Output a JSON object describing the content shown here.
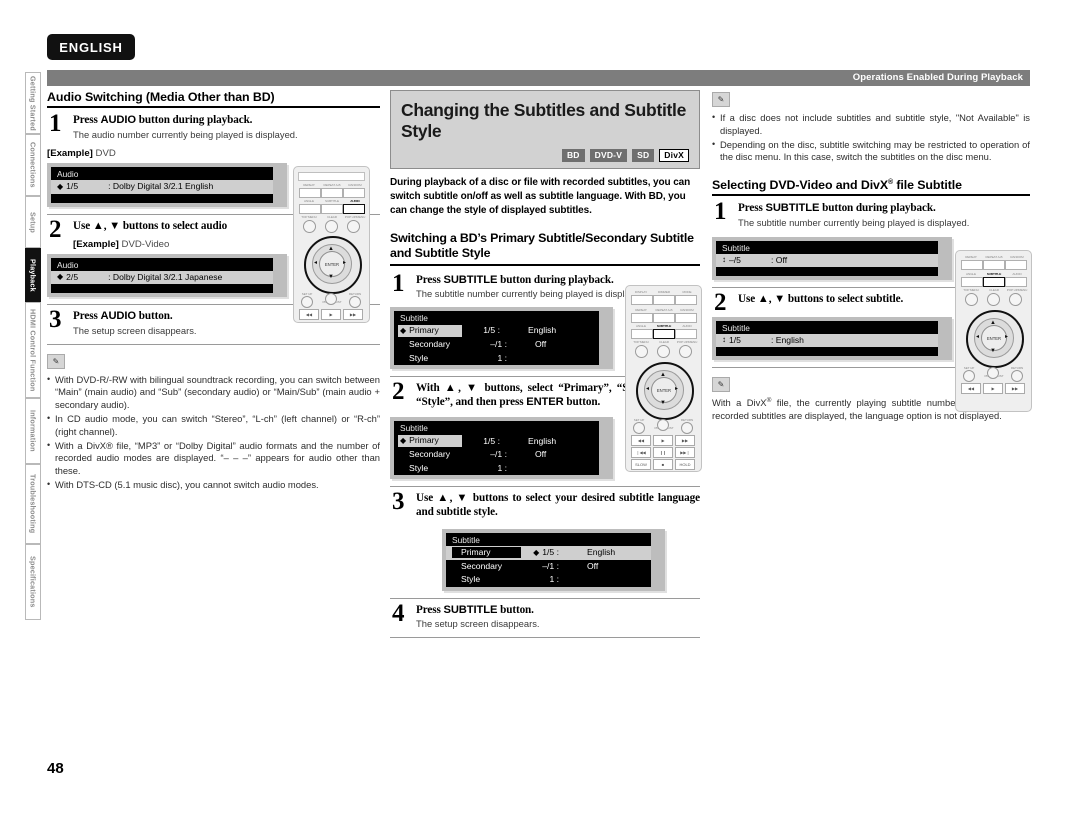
{
  "meta": {
    "language_badge": "ENGLISH",
    "page_number": "48",
    "header_right": "Operations Enabled During Playback"
  },
  "sidebar": {
    "items": [
      {
        "label": "Getting Started",
        "active": false
      },
      {
        "label": "Connections",
        "active": false
      },
      {
        "label": "Setup",
        "active": false
      },
      {
        "label": "Playback",
        "active": true
      },
      {
        "label": "HDMI Control Function",
        "active": false
      },
      {
        "label": "Information",
        "active": false
      },
      {
        "label": "Troubleshooting",
        "active": false
      },
      {
        "label": "Specifications",
        "active": false
      }
    ]
  },
  "col1": {
    "heading": "Audio Switching (Media Other than BD)",
    "steps": [
      {
        "num": "1",
        "title_a": "Press ",
        "title_b": "AUDIO",
        "title_c": " button during playback.",
        "sub": "The audio number currently being played is displayed."
      },
      {
        "num": "2",
        "title_a": "Use ▲, ▼ buttons to select audio",
        "title_b": "",
        "title_c": "",
        "sub": ""
      },
      {
        "num": "3",
        "title_a": "Press ",
        "title_b": "AUDIO",
        "title_c": " button.",
        "sub": "The setup screen disappears."
      }
    ],
    "example1": {
      "label": "[Example]",
      "value": "DVD"
    },
    "example2": {
      "label": "[Example]",
      "value": "DVD-Video"
    },
    "osd1": {
      "title": "Audio",
      "marker": "◆",
      "num": "1/5",
      "value": ": Dolby Digital   3/2.1   English"
    },
    "osd2": {
      "title": "Audio",
      "marker": "◆",
      "num": "2/5",
      "value": ": Dolby Digital   3/2.1   Japanese"
    },
    "notes": [
      "With DVD-R/-RW with bilingual soundtrack recording, you can switch between “Main” (main audio) and “Sub” (secondary audio) or “Main/Sub” (main audio + secondary audio).",
      "In CD audio mode, you can switch “Stereo”, “L-ch” (left channel) or “R-ch” (right channel).",
      "With a DivX® file, “MP3” or “Dolby Digital” audio formats and the number of recorded audio modes are displayed. “– – –” appears for audio other than these.",
      "With DTS-CD (5.1 music disc), you cannot switch audio modes."
    ]
  },
  "col2": {
    "title": "Changing the Subtitles and Subtitle Style",
    "badges": [
      {
        "text": "BD",
        "outline": false
      },
      {
        "text": "DVD-V",
        "outline": false
      },
      {
        "text": "SD",
        "outline": false
      },
      {
        "text": "DivX",
        "outline": true
      }
    ],
    "lead": "During playback of a disc or file with recorded subtitles, you can switch subtitle on/off as well as subtitle language. With BD, you can change the style of displayed subtitles.",
    "sub_heading": "Switching a BD’s Primary Subtitle/Secondary Subtitle and Subtitle Style",
    "steps": [
      {
        "num": "1",
        "title_a": "Press ",
        "title_b": "SUBTITLE",
        "title_c": " button during playback.",
        "sub": "The subtitle number currently being played is displayed."
      },
      {
        "num": "2",
        "title_a": "With ▲, ▼ buttons, select “Primary”, “Secondary” and “Style”, and then press ",
        "title_b": "ENTER",
        "title_c": " button.",
        "sub": ""
      },
      {
        "num": "3",
        "title_a": "Use ▲, ▼ buttons to select your desired subtitle language and subtitle style.",
        "title_b": "",
        "title_c": "",
        "sub": ""
      },
      {
        "num": "4",
        "title_a": "Press ",
        "title_b": "SUBTITLE",
        "title_c": " button.",
        "sub": "The setup screen disappears."
      }
    ],
    "osd": {
      "title": "Subtitle",
      "rows": [
        {
          "label": "Primary",
          "num": "1/5 :",
          "value": "English"
        },
        {
          "label": "Secondary",
          "num": "–/1 :",
          "value": "Off"
        },
        {
          "label": "Style",
          "num": "1 :",
          "value": ""
        }
      ],
      "marker": "◆"
    }
  },
  "col3": {
    "notes_top": [
      "If a disc does not include subtitles and subtitle style, \"Not Available\" is displayed.",
      "Depending on the disc, subtitle switching may be restricted to operation of the disc menu. In this case, switch the subtitles on the disc menu."
    ],
    "heading_a": "Selecting DVD-Video and DivX",
    "heading_sup": "®",
    "heading_b": " file Subtitle",
    "steps": [
      {
        "num": "1",
        "title_a": "Press ",
        "title_b": "SUBTITLE",
        "title_c": " button during playback.",
        "sub": "The subtitle number currently being played is displayed."
      },
      {
        "num": "2",
        "title_a": "Use ▲, ▼ buttons to select subtitle.",
        "title_b": "",
        "title_c": "",
        "sub": ""
      }
    ],
    "osd1": {
      "title": "Subtitle",
      "marker": "↕",
      "num": "–/5",
      "value": ": Off"
    },
    "osd2": {
      "title": "Subtitle",
      "marker": "↕",
      "num": "1/5",
      "value": ": English"
    },
    "note_bottom_a": "With a DivX",
    "note_bottom_sup": "®",
    "note_bottom_b": " file, the currently playing subtitle number and number of recorded subtitles are displayed, the language option is not displayed."
  },
  "remote": {
    "rows_top": [
      "DISPLAY",
      "DIMMER",
      "MODE"
    ],
    "rows_mid": [
      "REPEAT",
      "REPEAT A-B",
      "RANDOM"
    ],
    "rows_fn": [
      "ANGLE",
      "SUBTITLE",
      "AUDIO"
    ],
    "rows_menu": [
      "TOP MENU",
      "CLEAR",
      "POP UP/MENU"
    ],
    "rows_bottom": [
      "SET UP",
      "PICT. ADJUST",
      "RETURN"
    ],
    "enter": "ENTER",
    "transport": [
      "◀◀",
      "▶",
      "▶▶"
    ],
    "transport2": [
      "❘◀◀",
      "❙❙",
      "▶▶❘"
    ],
    "transport3": [
      "SLOW",
      "■",
      "HOLD"
    ]
  },
  "icons": {
    "pen": "✎"
  }
}
